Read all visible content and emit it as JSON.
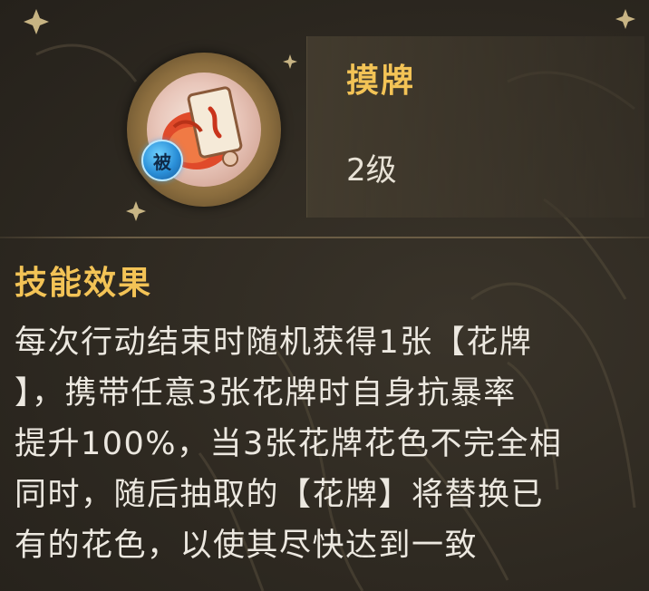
{
  "skill": {
    "name": "摸牌",
    "level": "2级",
    "passive_badge": "被",
    "icon": "hand-holding-card-icon"
  },
  "effect": {
    "title": "技能效果",
    "lines": [
      "每次行动结束时随机获得1张【花牌",
      "】，携带任意3张花牌时自身抗暴率",
      "提升100%，当3张花牌花色不完全相",
      "同时，随后抽取的【花牌】将替换已",
      "有的花色，以使其尽快达到一致"
    ]
  },
  "colors": {
    "title_gold": "#f3c356",
    "text_light": "#ece8e0",
    "badge_blue": "#2a8fd8",
    "background": "#2d2820"
  }
}
